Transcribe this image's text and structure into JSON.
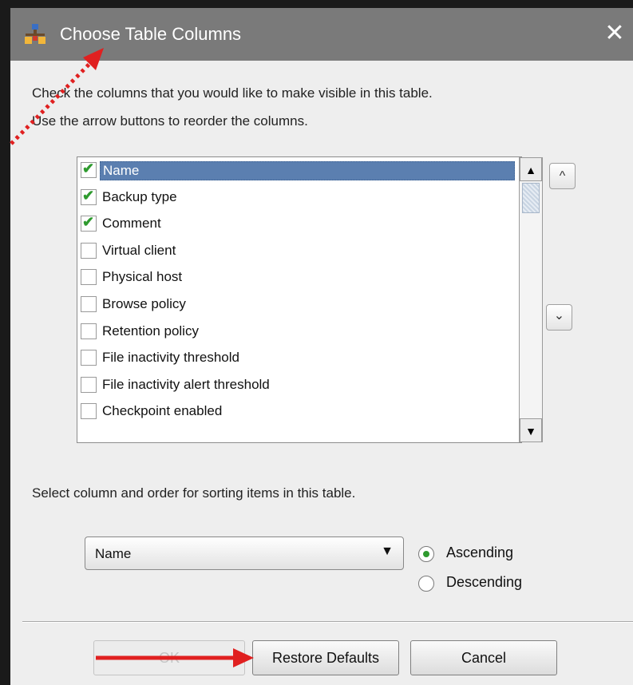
{
  "dialog": {
    "title": "Choose Table Columns",
    "close_glyph": "✕"
  },
  "instructions": {
    "line1": "Check the columns that you would like to make visible in this table.",
    "line2": "Use the arrow buttons to reorder the columns."
  },
  "columns": [
    {
      "label": "Name",
      "checked": true,
      "selected": true
    },
    {
      "label": "Backup type",
      "checked": true,
      "selected": false
    },
    {
      "label": "Comment",
      "checked": true,
      "selected": false
    },
    {
      "label": "Virtual client",
      "checked": false,
      "selected": false
    },
    {
      "label": "Physical host",
      "checked": false,
      "selected": false
    },
    {
      "label": "Browse policy",
      "checked": false,
      "selected": false
    },
    {
      "label": "Retention policy",
      "checked": false,
      "selected": false
    },
    {
      "label": "File inactivity threshold",
      "checked": false,
      "selected": false
    },
    {
      "label": "File inactivity alert threshold",
      "checked": false,
      "selected": false
    },
    {
      "label": "Checkpoint enabled",
      "checked": false,
      "selected": false
    }
  ],
  "reorder": {
    "up_glyph": "^",
    "down_glyph": "⌄"
  },
  "sorting": {
    "prompt": "Select column and order for sorting items in this table.",
    "selected_column": "Name",
    "order_options": [
      {
        "label": "Ascending",
        "selected": true
      },
      {
        "label": "Descending",
        "selected": false
      }
    ]
  },
  "buttons": {
    "ok": "OK",
    "restore": "Restore Defaults",
    "cancel": "Cancel"
  },
  "colors": {
    "titlebar": "#7a7a7a",
    "selection": "#5b7fb0",
    "check": "#2e9a2e",
    "annotation_arrow": "#e02020"
  },
  "icons": {
    "app": "network-tree-icon",
    "close": "close-icon",
    "check": "checkmark-icon",
    "dropdown": "caret-down-icon"
  }
}
